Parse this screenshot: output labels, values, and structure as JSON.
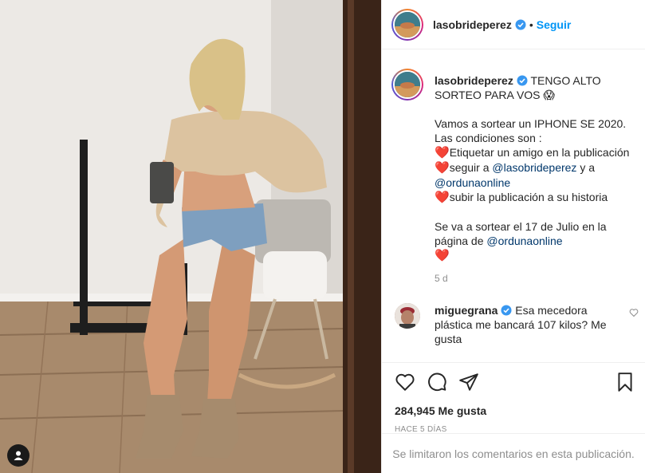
{
  "post": {
    "username": "lasobrideperez",
    "follow_label": "Seguir",
    "separator": "•"
  },
  "caption": {
    "username": "lasobrideperez",
    "first_line": "TENGO ALTO SORTEO PARA VOS",
    "first_emoji": "😱",
    "line1": "Vamos a sortear un IPHONE SE 2020.",
    "line2": "Las condiciones son :",
    "heart": "❤️",
    "cond1": "Etiquetar un amigo en la publicación",
    "cond2_prefix": "seguir a",
    "mention1": "@lasobrideperez",
    "cond2_mid": "y a",
    "mention2": "@ordunaonline",
    "cond3": "subir la publicación a su historia",
    "line_draw1": "Se va a sortear el 17 de Julio en la",
    "line_draw2_prefix": "página de",
    "mention3": "@ordunaonline",
    "time": "5 d"
  },
  "comment": {
    "username": "miguegrana",
    "text": "Esa mecedora plástica me bancará 107 kilos? Me gusta"
  },
  "actions": {
    "likes": "284,945 Me gusta",
    "date": "HACE 5 DÍAS"
  },
  "footer": {
    "limited_text": "Se limitaron los comentarios en esta publicación."
  },
  "colors": {
    "accent": "#0095f6",
    "mention": "#00376b",
    "muted": "#8e8e8e",
    "heart": "#ed2f3b"
  }
}
